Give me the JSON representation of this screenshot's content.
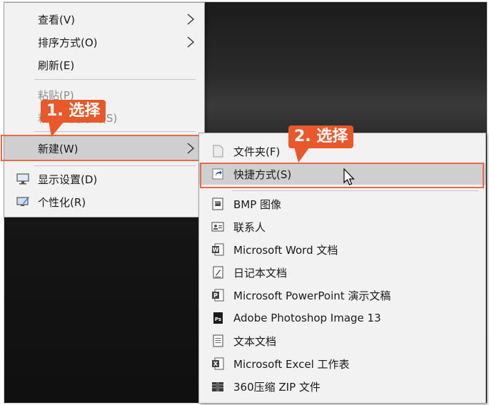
{
  "context_menu": {
    "items": [
      {
        "label": "查看(V)",
        "submenu": true
      },
      {
        "label": "排序方式(O)",
        "submenu": true
      },
      {
        "label": "刷新(E)"
      },
      {
        "label": "粘贴(P)",
        "disabled": true
      },
      {
        "label": "粘贴快捷方式(S)",
        "disabled": true
      },
      {
        "label": "新建(W)",
        "submenu": true,
        "highlighted": true
      },
      {
        "label": "显示设置(D)",
        "icon": "display-settings-icon"
      },
      {
        "label": "个性化(R)",
        "icon": "personalize-icon"
      }
    ]
  },
  "new_submenu": {
    "items": [
      {
        "label": "文件夹(F)",
        "icon": "folder-icon"
      },
      {
        "label": "快捷方式(S)",
        "icon": "shortcut-icon",
        "highlighted": true
      },
      {
        "label": "BMP 图像",
        "icon": "bmp-image-icon"
      },
      {
        "label": "联系人",
        "icon": "contact-icon"
      },
      {
        "label": "Microsoft Word 文档",
        "icon": "word-document-icon"
      },
      {
        "label": "日记本文档",
        "icon": "journal-document-icon"
      },
      {
        "label": "Microsoft PowerPoint 演示文稿",
        "icon": "powerpoint-icon"
      },
      {
        "label": "Adobe Photoshop Image 13",
        "icon": "photoshop-icon"
      },
      {
        "label": "文本文档",
        "icon": "text-document-icon"
      },
      {
        "label": "Microsoft Excel 工作表",
        "icon": "excel-icon"
      },
      {
        "label": "360压缩 ZIP 文件",
        "icon": "zip-archive-icon"
      }
    ]
  },
  "callouts": {
    "step1": "1. 选择",
    "step2": "2. 选择"
  },
  "colors": {
    "callout": "#e8582b",
    "highlight_box": "#e46c4a",
    "menu_bg": "#f2f2f2",
    "hover_bg": "#cfcfcf"
  }
}
